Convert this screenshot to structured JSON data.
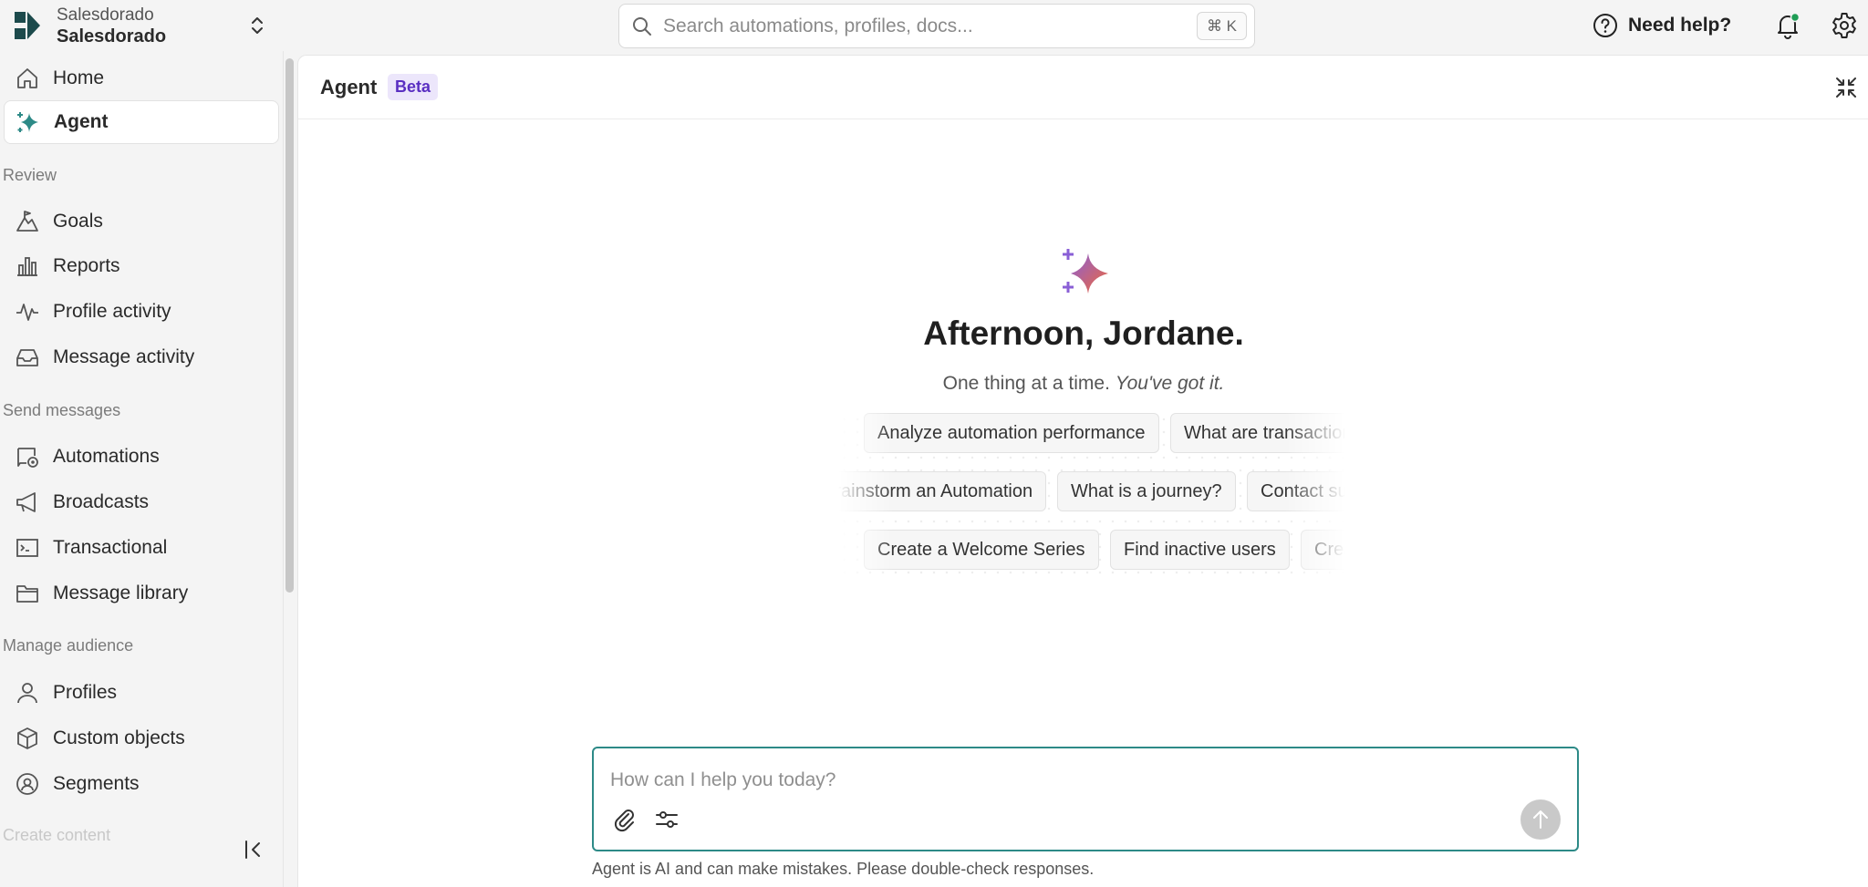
{
  "org": {
    "subtitle": "Salesdorado",
    "name": "Salesdorado"
  },
  "search": {
    "placeholder": "Search automations, profiles, docs...",
    "shortcut": "⌘ K"
  },
  "topbar": {
    "help_label": "Need help?",
    "notification_dot_color": "#1f9d55"
  },
  "sidebar": {
    "items_top": [
      {
        "label": "Home",
        "icon": "home-icon"
      },
      {
        "label": "Agent",
        "icon": "sparkle-icon",
        "active": true
      }
    ],
    "sections": [
      {
        "title": "Review",
        "items": [
          {
            "label": "Goals",
            "icon": "goals-icon"
          },
          {
            "label": "Reports",
            "icon": "reports-icon"
          },
          {
            "label": "Profile activity",
            "icon": "pulse-icon"
          },
          {
            "label": "Message activity",
            "icon": "inbox-icon"
          }
        ]
      },
      {
        "title": "Send messages",
        "items": [
          {
            "label": "Automations",
            "icon": "automation-icon"
          },
          {
            "label": "Broadcasts",
            "icon": "megaphone-icon"
          },
          {
            "label": "Transactional",
            "icon": "terminal-icon"
          },
          {
            "label": "Message library",
            "icon": "folder-icon"
          }
        ]
      },
      {
        "title": "Manage audience",
        "items": [
          {
            "label": "Profiles",
            "icon": "user-icon"
          },
          {
            "label": "Custom objects",
            "icon": "cube-icon"
          },
          {
            "label": "Segments",
            "icon": "segment-icon"
          }
        ]
      },
      {
        "title": "Create content",
        "items": []
      }
    ]
  },
  "main": {
    "title": "Agent",
    "badge": "Beta",
    "greeting": "Afternoon, Jordane.",
    "subtitle_plain": "One thing at a time.",
    "subtitle_italic": "You've got it.",
    "suggestions": [
      [
        "Analyze automation performance",
        "What are transactional messages?"
      ],
      [
        "Brainstorm an Automation",
        "What is a journey?",
        "Contact support"
      ],
      [
        "Create a Welcome Series",
        "Find inactive users",
        "Create a segment"
      ]
    ],
    "composer": {
      "placeholder": "How can I help you today?"
    },
    "disclaimer": "Agent is AI and can make mistakes. Please double-check responses."
  },
  "colors": {
    "accent": "#2d8a87",
    "brand": "#1c4a4c",
    "badge_bg": "#ece6fb",
    "badge_text": "#5a2fc2"
  }
}
